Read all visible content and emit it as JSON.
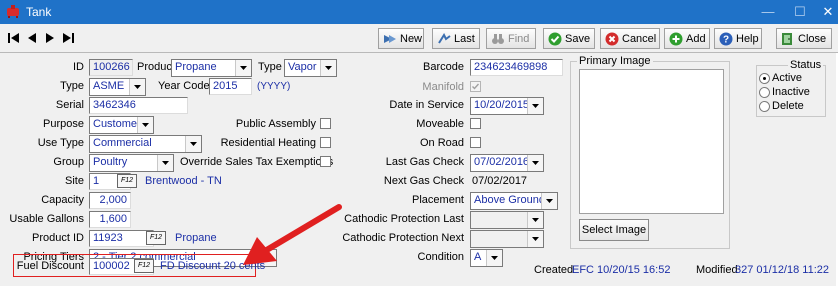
{
  "window": {
    "title": "Tank"
  },
  "toolbar": {
    "new_label": "New",
    "last_label": "Last",
    "find_label": "Find",
    "save_label": "Save",
    "cancel_label": "Cancel",
    "add_label": "Add",
    "help_label": "Help",
    "close_label": "Close"
  },
  "form": {
    "id_label": "ID",
    "id_value": "100266",
    "product_label": "Product",
    "product_value": "Propane",
    "type_label": "Type",
    "type_value": "Vapor",
    "type2_label": "Type",
    "type2_value": "ASME",
    "year_label": "Year Code",
    "year_value": "2015",
    "year_hint": "(YYYY)",
    "serial_label": "Serial",
    "serial_value": "3462346",
    "purpose_label": "Purpose",
    "purpose_value": "Customer",
    "public_assembly_label": "Public Assembly",
    "use_type_label": "Use Type",
    "use_type_value": "Commercial",
    "residential_heating_label": "Residential Heating",
    "group_label": "Group",
    "group_value": "Poultry",
    "override_label": "Override Sales Tax Exemptions",
    "site_label": "Site",
    "site_value": "1",
    "site_name": "Brentwood - TN",
    "capacity_label": "Capacity",
    "capacity_value": "2,000",
    "usable_label": "Usable Gallons",
    "usable_value": "1,600",
    "product_id_label": "Product ID",
    "product_id_value": "11923",
    "product_id_name": "Propane",
    "pricing_label": "Pricing Tiers",
    "pricing_value": "2 - Tier 2 commercial",
    "fuel_label": "Fuel Discount",
    "fuel_value": "100002",
    "fuel_name": "FD Discount 20 cents",
    "barcode_label": "Barcode",
    "barcode_value": "234623469898",
    "manifold_label": "Manifold",
    "date_service_label": "Date in Service",
    "date_service_value": "10/20/2015",
    "moveable_label": "Moveable",
    "on_road_label": "On Road",
    "last_gas_label": "Last Gas Check",
    "last_gas_value": "07/02/2016",
    "next_gas_label": "Next Gas Check",
    "next_gas_value": "07/02/2017",
    "placement_label": "Placement",
    "placement_value": "Above Ground",
    "cath_last_label": "Cathodic Protection Last",
    "cath_next_label": "Cathodic Protection Next",
    "condition_label": "Condition",
    "condition_value": "A",
    "primary_image_label": "Primary Image",
    "select_image_label": "Select Image",
    "status_label": "Status",
    "status_options": [
      "Active",
      "Inactive",
      "Delete"
    ],
    "status_selected": "Active",
    "created_label": "Created",
    "created_value": "EFC 10/20/15 16:52",
    "modified_label": "Modified",
    "modified_value": "327 01/12/18 11:22",
    "f2_label": "F12"
  },
  "colors": {
    "titlebar": "#1f72c8",
    "value_text": "#1c2fa6",
    "annotation": "#e02020"
  }
}
